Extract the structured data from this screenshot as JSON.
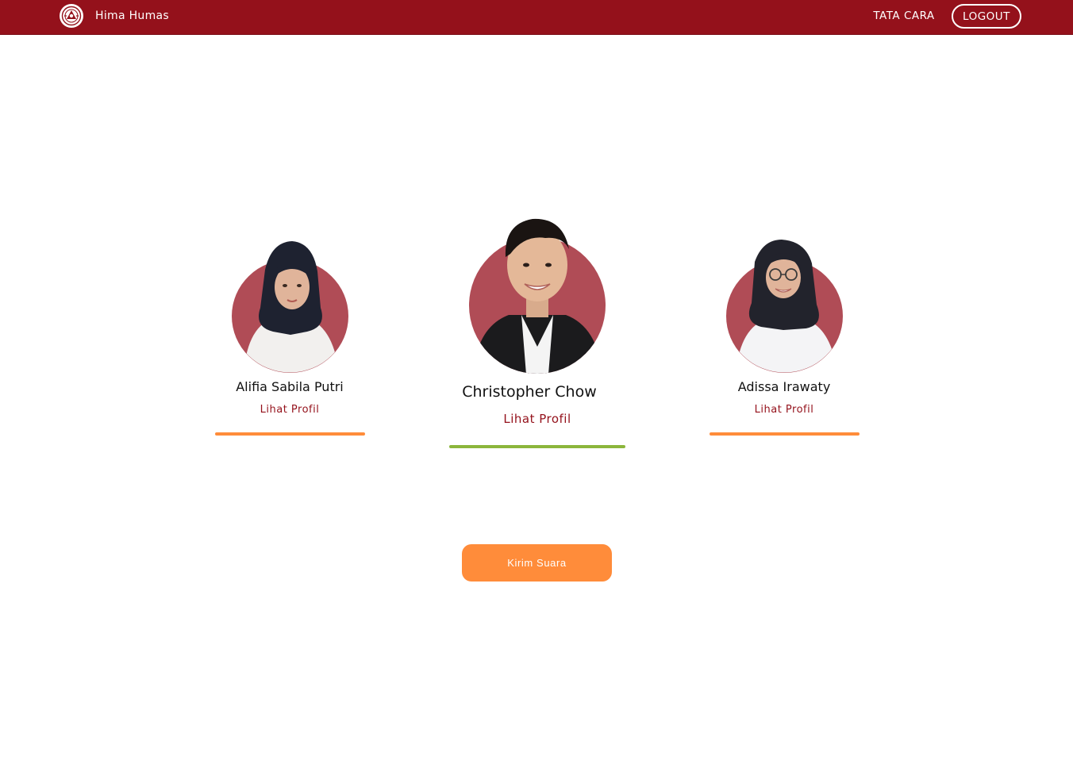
{
  "navbar": {
    "brand_name": "Hima Humas",
    "logo_icon": "hima-emblem-icon",
    "tata_cara_label": "TATA CARA",
    "logout_label": "LOGOUT",
    "background_color": "#94111b"
  },
  "candidates": [
    {
      "name": "Alifia Sabila Putri",
      "link_label": "Lihat Profil",
      "bar_color": "#ff8c3a",
      "selected": false
    },
    {
      "name": "Christopher Chow",
      "link_label": "Lihat Profil",
      "bar_color": "#8cb63c",
      "selected": true
    },
    {
      "name": "Adissa Irawaty",
      "link_label": "Lihat Profil",
      "bar_color": "#ff8c3a",
      "selected": false
    }
  ],
  "submit": {
    "label": "Kirim Suara",
    "color": "#ff8c3a"
  },
  "colors": {
    "accent": "#94111b",
    "photo_circle": "#b04c56"
  }
}
